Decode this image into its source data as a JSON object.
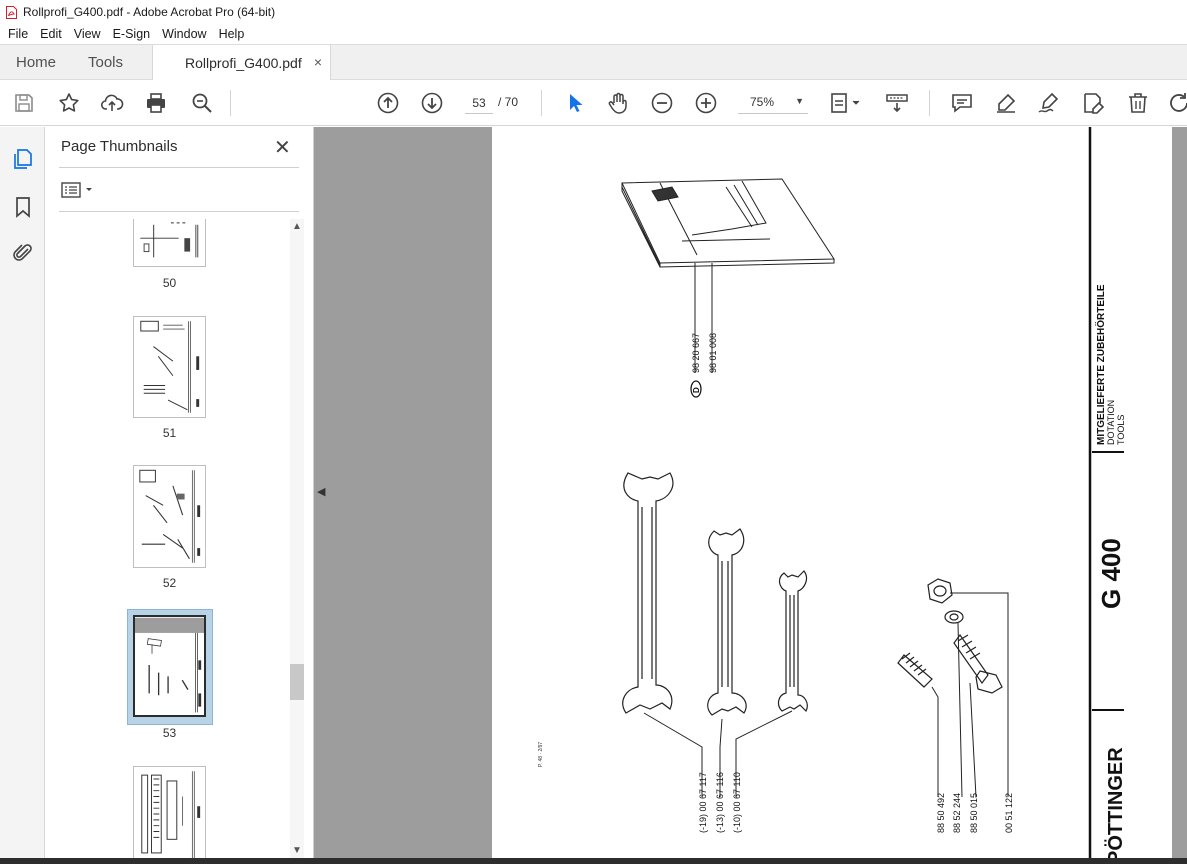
{
  "window": {
    "title": "Rollprofi_G400.pdf - Adobe Acrobat Pro (64-bit)"
  },
  "menu": [
    "File",
    "Edit",
    "View",
    "E-Sign",
    "Window",
    "Help"
  ],
  "tabs": {
    "home": "Home",
    "tools": "Tools",
    "document": "Rollprofi_G400.pdf",
    "close": "×"
  },
  "toolbar": {
    "current_page": "53",
    "total_pages": "/ 70",
    "zoom": "75%",
    "icons": [
      "save-icon",
      "star-icon",
      "upload-icon",
      "print-icon",
      "zoom-search-icon",
      "page-up-icon",
      "page-down-icon",
      "select-arrow-icon",
      "hand-icon",
      "zoom-out-icon",
      "zoom-in-icon",
      "page-fit-icon",
      "scroll-mode-icon",
      "comment-icon",
      "highlight-pen-icon",
      "sign-icon",
      "edit-pdf-icon",
      "delete-icon",
      "rotate-icon"
    ]
  },
  "sidebar": {
    "title": "Page Thumbnails",
    "close": "✕",
    "thumbnails": [
      {
        "label": "50"
      },
      {
        "label": "51"
      },
      {
        "label": "52"
      },
      {
        "label": "53",
        "selected": true
      },
      {
        "label": ""
      }
    ]
  },
  "pdf_page": {
    "side_header": "MITGELIEFERTE ZUBEHÖRTEILE",
    "side_sub1": "DOTATION",
    "side_sub2": "TOOLS",
    "model": "G 400",
    "brand": "PÖTTINGER",
    "book_parts": [
      "98 20 667",
      "98 01 008"
    ],
    "book_marker": "D",
    "wrench_parts": [
      "(-19) 00 67 117",
      "(-13) 00 67 116",
      "(-10) 00 67 110"
    ],
    "hardware_parts": [
      "88 50 492",
      "88 52 244",
      "88 50 015",
      "00 51 122"
    ],
    "footer_code": "P. 48 · 2/97"
  }
}
